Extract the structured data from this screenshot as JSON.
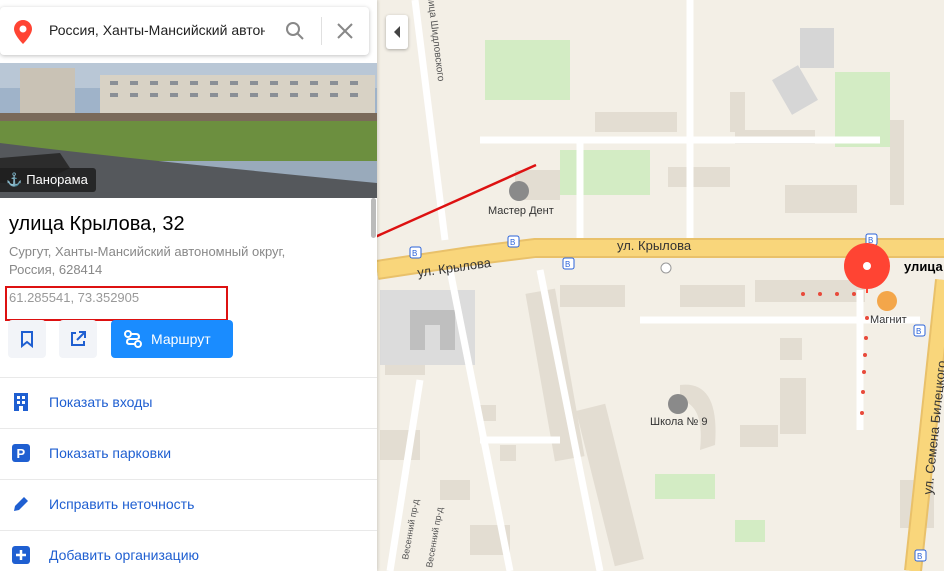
{
  "search": {
    "query": "Россия, Ханты-Мансийский автон"
  },
  "panorama": {
    "label": "Панорама"
  },
  "place": {
    "title": "улица Крылова, 32",
    "address_line1": "Сургут, Ханты-Мансийский автономный округ,",
    "address_line2": "Россия, 628414",
    "coords": "61.285541, 73.352905"
  },
  "buttons": {
    "route_label": "Маршрут"
  },
  "actions": [
    {
      "label": "Показать входы",
      "icon": "building-icon"
    },
    {
      "label": "Показать парковки",
      "icon": "parking-icon"
    },
    {
      "label": "Исправить неточность",
      "icon": "pencil-icon"
    },
    {
      "label": "Добавить организацию",
      "icon": "plus-icon"
    }
  ],
  "map": {
    "streets": {
      "krylova_main": "ул. Крылова",
      "krylova_left": "ул. Крылова",
      "krylova_right": "улица Крылова",
      "shidlovskogo": "улица Шидловского",
      "bilecki": "ул. Семена Билецкого",
      "vesenniy1": "Весенний пр-д",
      "vesenniy2": "Весенний пр-д"
    },
    "pois": {
      "dentist": "Мастер Дент",
      "magnit": "Магнит",
      "school": "Школа № 9"
    }
  },
  "colors": {
    "accent": "#1a8cff",
    "marker": "#f43",
    "highlight": "#d11",
    "road": "#f9d67b"
  }
}
